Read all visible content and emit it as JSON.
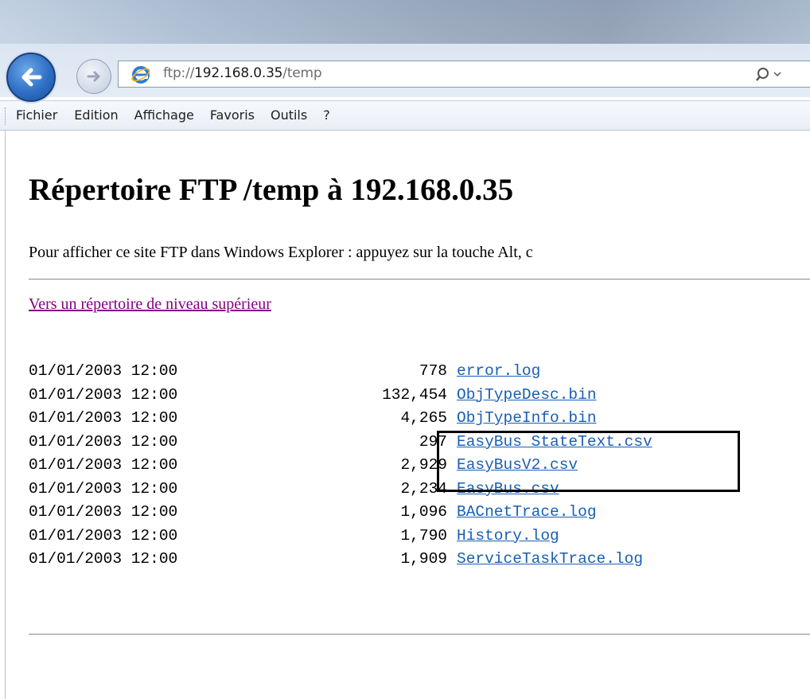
{
  "browser": {
    "address_url_prefix": "ftp://",
    "address_url_host": "192.168.0.35",
    "address_url_path": "/temp",
    "menu": [
      "Fichier",
      "Edition",
      "Affichage",
      "Favoris",
      "Outils",
      "?"
    ]
  },
  "page": {
    "heading": "Répertoire FTP /temp à 192.168.0.35",
    "info_text": "Pour afficher ce site FTP dans Windows Explorer : appuyez sur la touche Alt, c",
    "parent_link": "Vers un répertoire de niveau supérieur"
  },
  "files": [
    {
      "date": "01/01/2003 12:00",
      "size": "778",
      "name": "error.log"
    },
    {
      "date": "01/01/2003 12:00",
      "size": "132,454",
      "name": "ObjTypeDesc.bin"
    },
    {
      "date": "01/01/2003 12:00",
      "size": "4,265",
      "name": "ObjTypeInfo.bin"
    },
    {
      "date": "01/01/2003 12:00",
      "size": "297",
      "name": "EasyBus_StateText.csv"
    },
    {
      "date": "01/01/2003 12:00",
      "size": "2,929",
      "name": "EasyBusV2.csv"
    },
    {
      "date": "01/01/2003 12:00",
      "size": "2,234",
      "name": "EasyBus.csv"
    },
    {
      "date": "01/01/2003 12:00",
      "size": "1,096",
      "name": "BACnetTrace.log"
    },
    {
      "date": "01/01/2003 12:00",
      "size": "1,790",
      "name": "History.log"
    },
    {
      "date": "01/01/2003 12:00",
      "size": "1,909",
      "name": "ServiceTaskTrace.log"
    }
  ],
  "colors": {
    "link": "#1a5fb4",
    "visited_link": "#800080"
  }
}
